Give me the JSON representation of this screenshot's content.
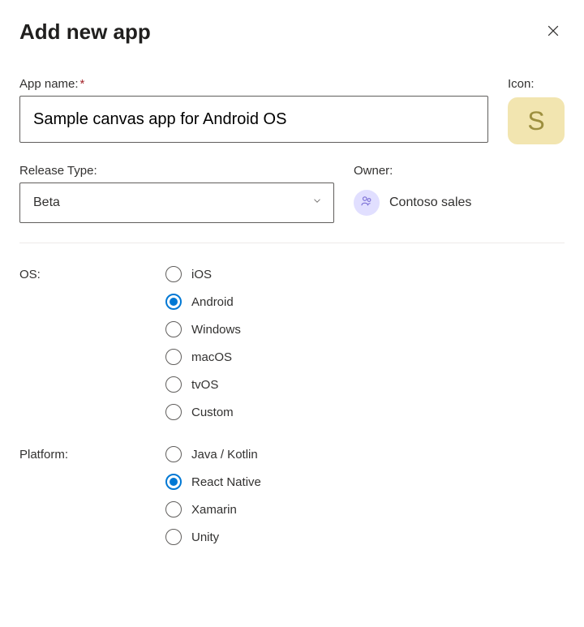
{
  "header": {
    "title": "Add new app"
  },
  "appName": {
    "label": "App name:",
    "value": "Sample canvas app for Android OS"
  },
  "icon": {
    "label": "Icon:",
    "letter": "S"
  },
  "releaseType": {
    "label": "Release Type:",
    "selected": "Beta"
  },
  "owner": {
    "label": "Owner:",
    "name": "Contoso sales"
  },
  "os": {
    "label": "OS:",
    "selected": "Android",
    "options": [
      "iOS",
      "Android",
      "Windows",
      "macOS",
      "tvOS",
      "Custom"
    ]
  },
  "platform": {
    "label": "Platform:",
    "selected": "React Native",
    "options": [
      "Java / Kotlin",
      "React Native",
      "Xamarin",
      "Unity"
    ]
  }
}
